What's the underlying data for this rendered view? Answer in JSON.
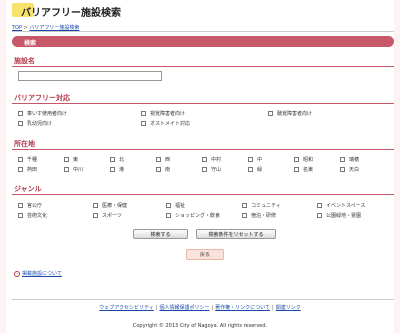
{
  "page": {
    "title": "バリアフリー施設検索"
  },
  "breadcrumb": {
    "home": "TOP",
    "separator": ">",
    "current": "バリアフリー施設検索"
  },
  "search_header": "検索",
  "facility_name": {
    "title": "施設名",
    "value": ""
  },
  "barrier_free": {
    "title": "バリアフリー対応",
    "options": [
      "車いす使用者向け",
      "視覚障害者向け",
      "聴覚障害者向け",
      "乳幼児向け",
      "オストメイト対応"
    ]
  },
  "location": {
    "title": "所在地",
    "wards": [
      "千種",
      "東",
      "北",
      "西",
      "中村",
      "中",
      "昭和",
      "瑞穂",
      "熱田",
      "中川",
      "港",
      "南",
      "守山",
      "緑",
      "名東",
      "天白"
    ]
  },
  "genre": {
    "title": "ジャンル",
    "options": [
      "官公庁",
      "医療・保健",
      "福祉",
      "コミュニティ",
      "イベントスペース",
      "芸術文化",
      "スポーツ",
      "ショッピング・飲食",
      "宿泊・研修",
      "公園緑地・霊園"
    ]
  },
  "buttons": {
    "search": "検索する",
    "reset": "検索条件をリセットする",
    "back": "戻る"
  },
  "about_link": "掲載施設について",
  "footer": {
    "links": [
      "ウェブアクセシビリティ",
      "個人情報保護ポリシー",
      "著作権・リンクについて",
      "関連リンク"
    ],
    "copyright": "Copyright © 2013 City of Nagoya. All rights reserved."
  },
  "colors": {
    "accent": "#c7586a",
    "section_title": "#b23a4a",
    "link": "#1a4aa8",
    "title_deco": "#f7e36b"
  }
}
